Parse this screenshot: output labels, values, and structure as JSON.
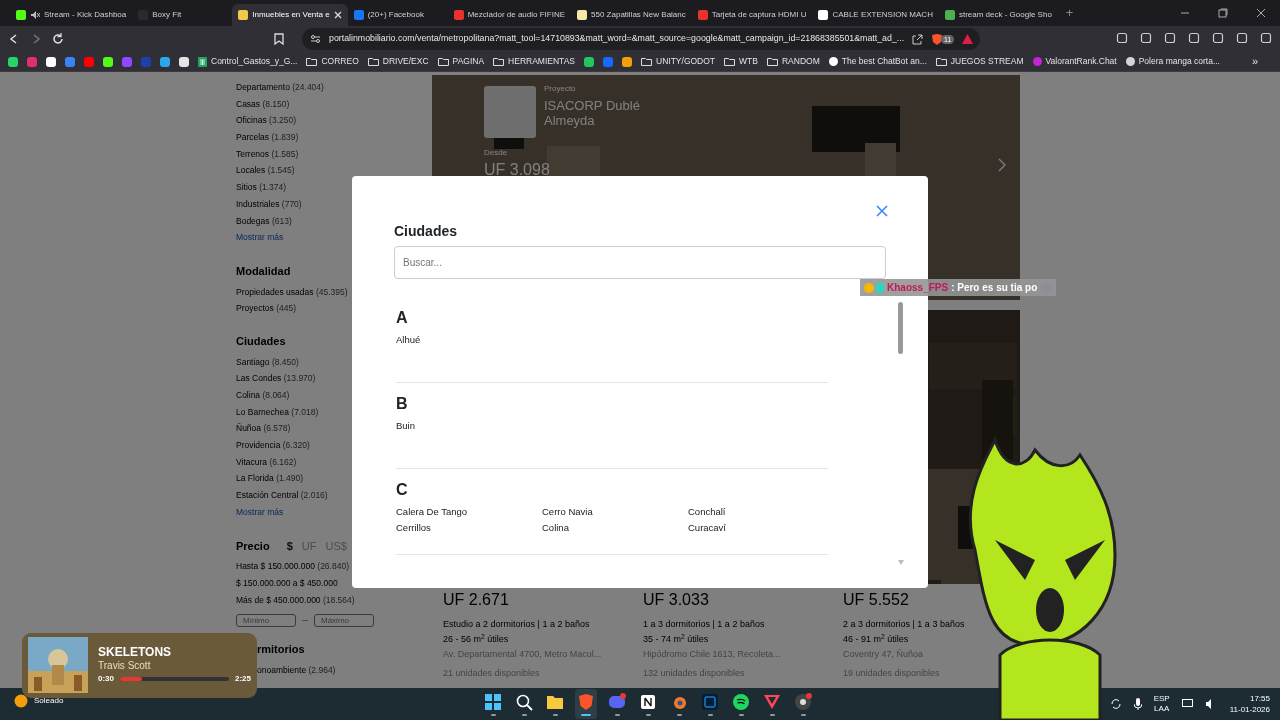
{
  "browser": {
    "tabs": [
      {
        "title": "Stream - Kick Dashboa",
        "selected": false,
        "muted": true,
        "color": "#53fc18"
      },
      {
        "title": "Boxy Fit",
        "selected": false,
        "muted": false,
        "color": "#2a2a2a"
      },
      {
        "title": "Inmuebles en Venta e",
        "selected": true,
        "muted": false,
        "color": "#f2c94c"
      },
      {
        "title": "(20+) Facebook",
        "selected": false,
        "muted": false,
        "color": "#1877f2"
      },
      {
        "title": "Mezclador de audio FIFINE",
        "selected": false,
        "muted": false,
        "color": "#e8322d"
      },
      {
        "title": "550 Zapatillas New Balanc",
        "selected": false,
        "muted": false,
        "color": "#f5e9a8"
      },
      {
        "title": "Tarjeta de captura HDMI U",
        "selected": false,
        "muted": false,
        "color": "#e8322d"
      },
      {
        "title": "CABLE EXTENSION MACH",
        "selected": false,
        "muted": false,
        "color": "#ffffff"
      },
      {
        "title": "stream deck - Google Sho",
        "selected": false,
        "muted": false,
        "color": "#4caf50"
      }
    ],
    "new_tab": "+",
    "address": "portalinmobiliario.com/venta/metropolitana?matt_tool=14710893&matt_word=&matt_source=google&matt_campaign_id=21868385501&matt_ad_...",
    "shield_count": "11",
    "bookmarks": [
      {
        "kind": "icon",
        "color": "#25d366"
      },
      {
        "kind": "icon",
        "color": "#e1306c"
      },
      {
        "kind": "icon",
        "color": "#ffffff"
      },
      {
        "kind": "icon",
        "color": "#3b82f6"
      },
      {
        "kind": "icon",
        "color": "#ff0000"
      },
      {
        "kind": "icon",
        "color": "#53fc18"
      },
      {
        "kind": "icon",
        "color": "#9146ff"
      },
      {
        "kind": "icon",
        "color": "#1e40af"
      },
      {
        "kind": "icon",
        "color": "#29a9eb"
      },
      {
        "kind": "icon",
        "color": "#e5e5e5"
      },
      {
        "kind": "sheet",
        "label": "Control_Gastos_y_G..."
      },
      {
        "kind": "folder",
        "label": "CORREO"
      },
      {
        "kind": "folder",
        "label": "DRIVE/EXC"
      },
      {
        "kind": "folder",
        "label": "PAGINA"
      },
      {
        "kind": "folder",
        "label": "HERRAMIENTAS"
      },
      {
        "kind": "icon",
        "color": "#22c55e"
      },
      {
        "kind": "icon",
        "color": "#1769ff"
      },
      {
        "kind": "icon",
        "color": "#f59e0b"
      },
      {
        "kind": "folder",
        "label": "UNITY/GODOT"
      },
      {
        "kind": "folder",
        "label": "WTB"
      },
      {
        "kind": "folder",
        "label": "RANDOM"
      },
      {
        "kind": "site",
        "label": "The best ChatBot an...",
        "color": "#ffffff"
      },
      {
        "kind": "folder",
        "label": "JUEGOS STREAM"
      },
      {
        "kind": "site",
        "label": "ValorantRank.Chat",
        "color": "#c026d3"
      },
      {
        "kind": "site",
        "label": "Polera manga corta...",
        "color": "#d1d5db"
      }
    ],
    "bookmarks_more": "»"
  },
  "sidebar": {
    "sections": [
      {
        "kind": "list",
        "items": [
          {
            "label": "Departamento",
            "count": "(24.404)"
          },
          {
            "label": "Casas",
            "count": "(8.150)"
          },
          {
            "label": "Oficinas",
            "count": "(3.250)"
          },
          {
            "label": "Parcelas",
            "count": "(1.839)"
          },
          {
            "label": "Terrenos",
            "count": "(1.585)"
          },
          {
            "label": "Locales",
            "count": "(1.545)"
          },
          {
            "label": "Sitios",
            "count": "(1.374)"
          },
          {
            "label": "Industriales",
            "count": "(770)"
          },
          {
            "label": "Bodegas",
            "count": "(613)"
          }
        ],
        "more": "Mostrar más"
      },
      {
        "kind": "list",
        "title": "Modalidad",
        "items": [
          {
            "label": "Propiedades usadas",
            "count": "(45.395)"
          },
          {
            "label": "Proyectos",
            "count": "(445)"
          }
        ]
      },
      {
        "kind": "list",
        "title": "Ciudades",
        "items": [
          {
            "label": "Santiago",
            "count": "(8.450)"
          },
          {
            "label": "Las Condes",
            "count": "(13.970)"
          },
          {
            "label": "Colina",
            "count": "(8.064)"
          },
          {
            "label": "Lo Barnechea",
            "count": "(7.018)"
          },
          {
            "label": "Ñuñoa",
            "count": "(6.578)"
          },
          {
            "label": "Providencia",
            "count": "(6.320)"
          },
          {
            "label": "Vitacura",
            "count": "(6.162)"
          },
          {
            "label": "La Florida",
            "count": "(1.490)"
          },
          {
            "label": "Estación Central",
            "count": "(2.016)"
          }
        ],
        "more": "Mostrar más"
      },
      {
        "kind": "price",
        "title": "Precio",
        "currencies": [
          {
            "label": "$",
            "selected": true
          },
          {
            "label": "UF",
            "selected": false
          },
          {
            "label": "US$",
            "selected": false
          }
        ],
        "items": [
          {
            "label": "Hasta $ 150.000.000",
            "count": "(26.840)"
          },
          {
            "label": "$ 150.000.000 a $ 450.000"
          },
          {
            "label": "Más de $ 450.000.000",
            "count": "(18.564)"
          }
        ],
        "min_placeholder": "Mínimo",
        "max_placeholder": "Máximo"
      },
      {
        "kind": "partial",
        "title": "rmitorios",
        "items": [
          {
            "label": "onoambiente",
            "count": "(2.964)"
          }
        ]
      }
    ]
  },
  "featured": {
    "tag": "Proyecto",
    "name": "ISACORP Dublé Almeyda",
    "from": "Desde",
    "price": "UF 3.098"
  },
  "listings": [
    {
      "price": "UF 2.671",
      "rooms": "Estudio a 2 dormitorios | 1 a 2 baños",
      "area": "26 - 56 m$^{2}$ útiles",
      "address": "Av. Departamental 4700, Metro Macul...",
      "units": "21 unidades disponibles"
    },
    {
      "price": "UF 3.033",
      "rooms": "1 a 3 dormitorios | 1 a 2 baños",
      "area": "35 - 74 m$^{2}$ útiles",
      "address": "Hipódromo Chile 1613, Recoleta...",
      "units": "132 unidades disponibles"
    },
    {
      "price": "UF 5.552",
      "rooms": "2 a 3 dormitorios | 1 a 3 baños",
      "area": "46 - 91 m$^{2}$ útiles",
      "address": "Coventry 47, Ñuñoa",
      "units": "19 unidades disponibles"
    }
  ],
  "modal": {
    "title": "Ciudades",
    "search": {
      "placeholder": "Buscar..."
    },
    "groups": [
      {
        "letter": "A",
        "cities": [
          "Alhué"
        ]
      },
      {
        "letter": "B",
        "cities": [
          "Buin"
        ]
      },
      {
        "letter": "C",
        "cities": [
          "Calera De Tango",
          "Cerrillos",
          "Cerro Navia",
          "Colina",
          "Conchalí",
          "Curacaví"
        ]
      }
    ]
  },
  "chat": {
    "user": "Khaoss_FPS",
    "message": ": Pero es su tia po"
  },
  "music": {
    "title": "SKELETONS",
    "artist": "Travis Scott",
    "elapsed": "0:30",
    "total": "2:25",
    "level": 0.2
  },
  "taskbar": {
    "weather": "Soleado",
    "apps": [
      {
        "kind": "start",
        "selected": false
      },
      {
        "kind": "search",
        "selected": false
      },
      {
        "kind": "files",
        "selected": false
      },
      {
        "kind": "lion",
        "selected": true
      },
      {
        "kind": "chat",
        "selected": false
      },
      {
        "kind": "notes",
        "selected": false
      },
      {
        "kind": "blender",
        "selected": false
      },
      {
        "kind": "editor",
        "selected": false
      },
      {
        "kind": "music",
        "selected": false
      },
      {
        "kind": "game",
        "selected": false
      },
      {
        "kind": "record",
        "selected": false
      }
    ],
    "lang": "ESP",
    "layout": "LAA",
    "time": "17:55",
    "date": "11-01-2026"
  }
}
